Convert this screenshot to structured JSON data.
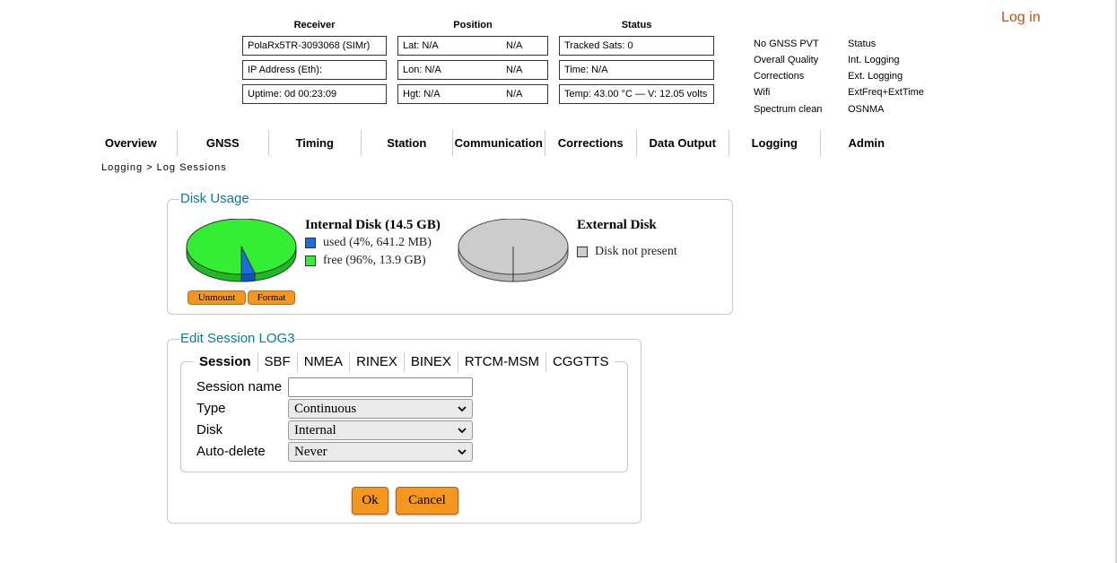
{
  "header": {
    "receiver_title": "Receiver",
    "position_title": "Position",
    "status_title": "Status",
    "receiver": {
      "name": "PolaRx5TR-3093068 (SIMr)",
      "ip": "IP Address (Eth):",
      "uptime": "Uptime: 0d 00:23:09"
    },
    "position": {
      "lat_label": "Lat:  N/A",
      "lat_value": "N/A",
      "lon_label": "Lon: N/A",
      "lon_value": "N/A",
      "hgt_label": "Hgt:  N/A",
      "hgt_value": "N/A"
    },
    "status": {
      "tracked": "Tracked Sats: 0",
      "time": "Time: N/A",
      "temp": "Temp: 43.00 °C — V: 12.05 volts"
    },
    "indicators_left": [
      "No GNSS PVT",
      "Overall Quality",
      "Corrections",
      "Wifi",
      "Spectrum clean"
    ],
    "indicators_right": [
      "Status",
      "Int. Logging",
      "Ext. Logging",
      "ExtFreq+ExtTime",
      "OSNMA"
    ],
    "login": "Log in",
    "login_color": "#c0501f"
  },
  "nav": {
    "items": [
      "Overview",
      "GNSS",
      "Timing",
      "Station",
      "Communication",
      "Corrections",
      "Data Output",
      "Logging",
      "Admin"
    ]
  },
  "breadcrumb": "Logging > Log Sessions",
  "disk_usage": {
    "legend": "Disk Usage",
    "internal": {
      "title": "Internal Disk (14.5 GB)",
      "used_label": "used (4%, 641.2 MB)",
      "free_label": "free (96%, 13.9 GB)",
      "used_fraction": 0.04,
      "used_color": "#1a6fe0",
      "free_color": "#33ee33"
    },
    "external": {
      "title": "External Disk",
      "status_label": "Disk not present",
      "color": "#cccccc"
    },
    "unmount_label": "Unmount",
    "format_label": "Format"
  },
  "session": {
    "legend": "Edit Session LOG3",
    "tabs": [
      "Session",
      "SBF",
      "NMEA",
      "RINEX",
      "BINEX",
      "RTCM-MSM",
      "CGGTTS"
    ],
    "active_tab": "Session",
    "fields": {
      "name_label": "Session name",
      "name_value": "",
      "type_label": "Type",
      "type_value": "Continuous",
      "disk_label": "Disk",
      "disk_value": "Internal",
      "autodelete_label": "Auto-delete",
      "autodelete_value": "Never"
    },
    "ok_label": "Ok",
    "cancel_label": "Cancel"
  },
  "accent_color": "#0a7a9c",
  "button_color": "#f5961e"
}
